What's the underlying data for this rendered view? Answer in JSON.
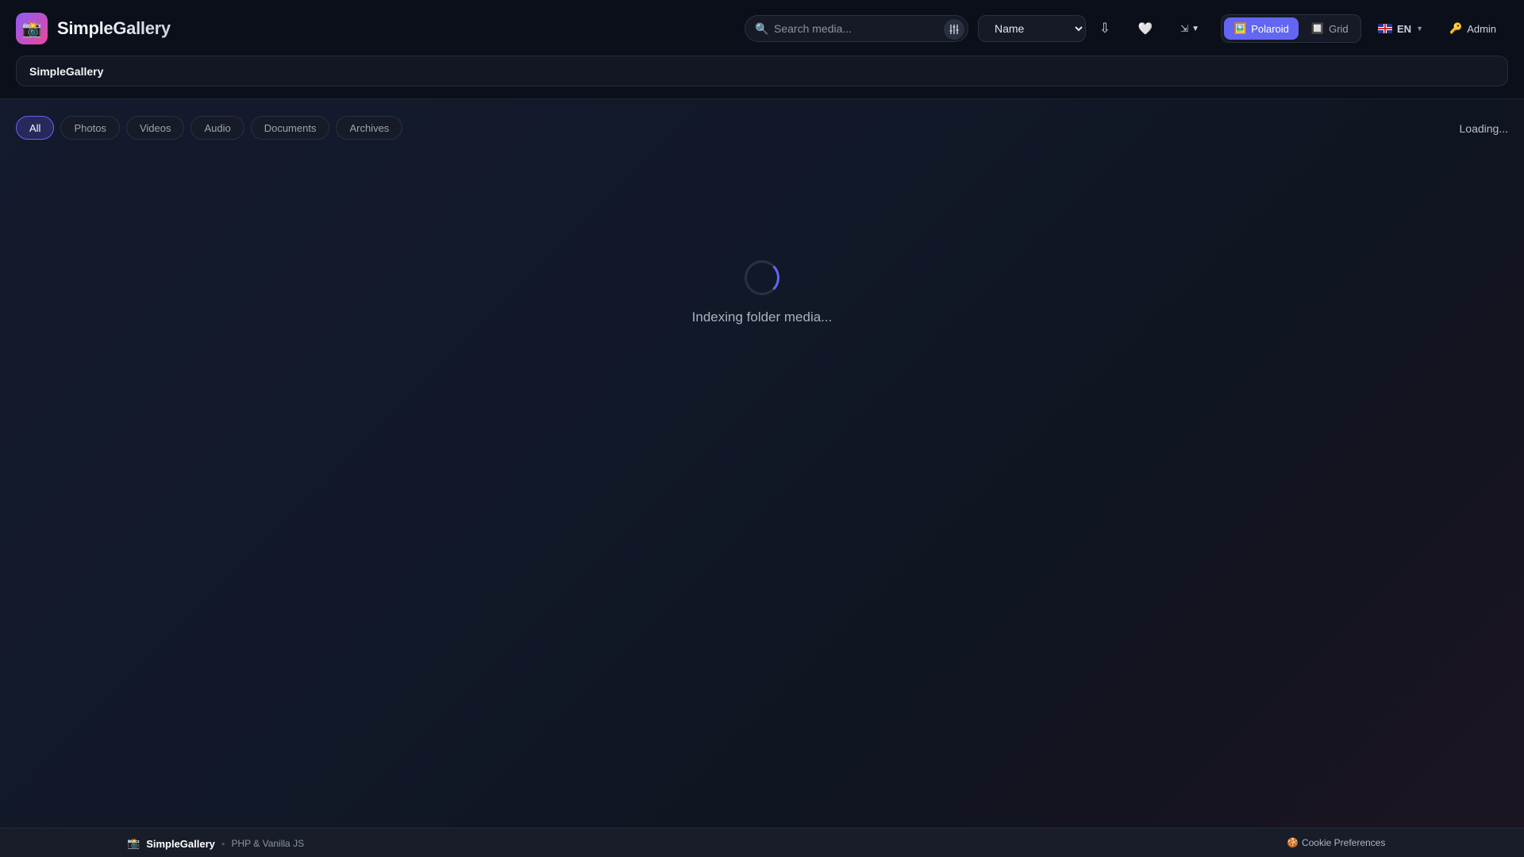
{
  "header": {
    "brand": "SimpleGallery",
    "logo_icon": "📸",
    "search_placeholder": "Search media...",
    "sort_value": "Name",
    "sort_options": [
      "Name"
    ],
    "view": {
      "polaroid_label": "Polaroid",
      "grid_label": "Grid",
      "active": "Polaroid"
    },
    "language_label": "EN",
    "admin_label": "Admin"
  },
  "breadcrumb": {
    "current": "SimpleGallery"
  },
  "filters": {
    "tabs": [
      "All",
      "Photos",
      "Videos",
      "Audio",
      "Documents",
      "Archives"
    ],
    "active": "All"
  },
  "status": {
    "label": "Loading...",
    "message": "Indexing folder media..."
  },
  "footer": {
    "brand": "SimpleGallery",
    "tech": "PHP & Vanilla JS",
    "cookie_label": "Cookie Preferences"
  },
  "colors": {
    "accent": "#6366f1",
    "background": "#0f1420",
    "logo_gradient_start": "#8b5cf6",
    "logo_gradient_end": "#ec4899"
  }
}
